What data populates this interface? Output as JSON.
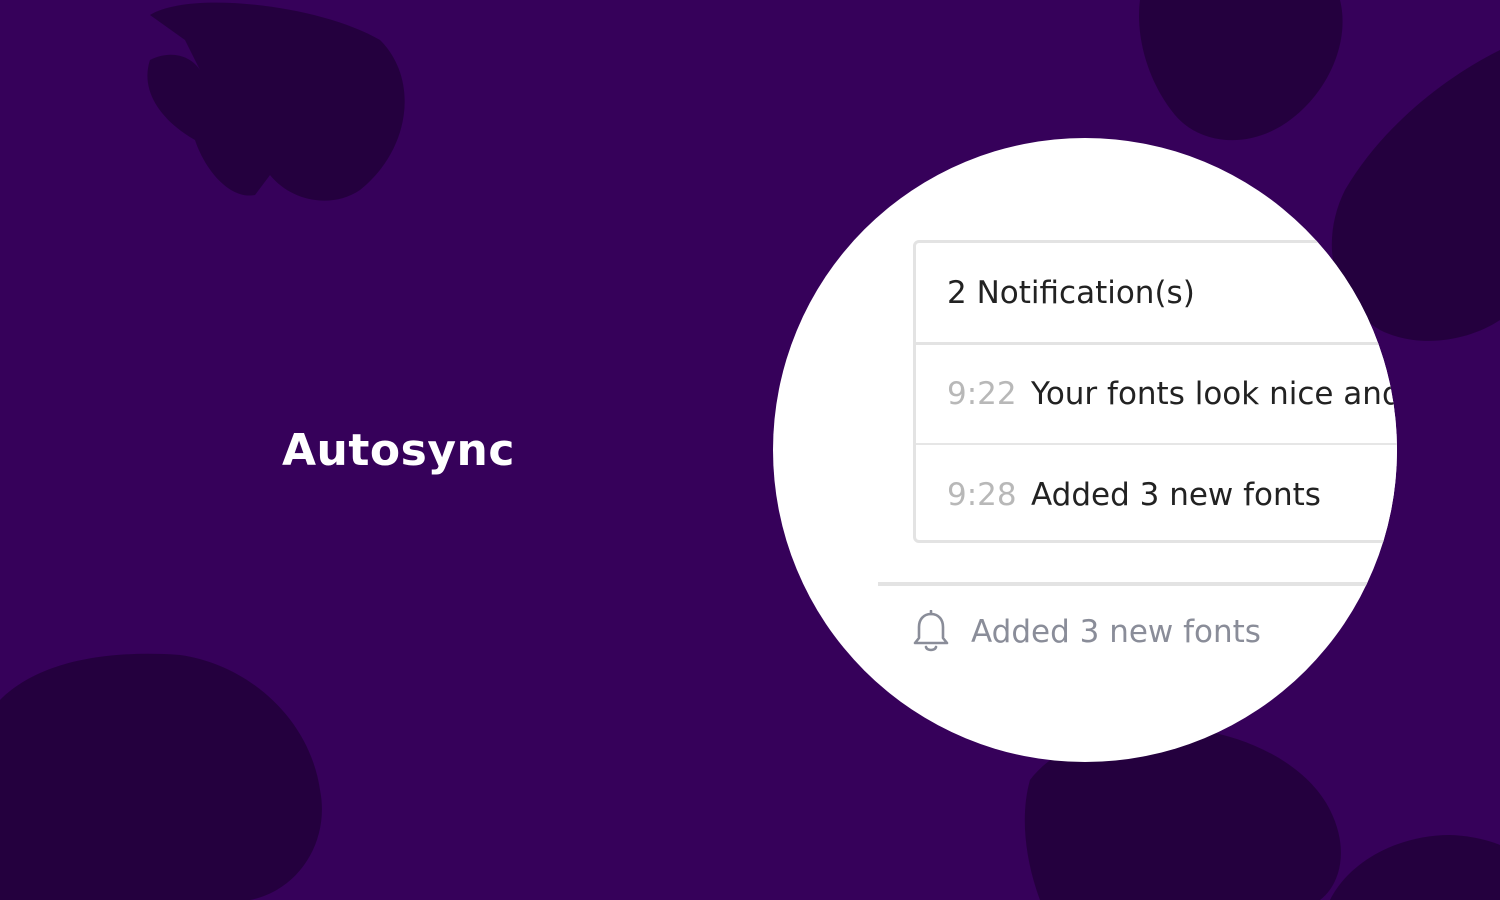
{
  "headline": "Autosync",
  "notifications": {
    "count_label": "2 Notification(s)",
    "items": [
      {
        "time": "9:22",
        "text": "Your fonts look nice and"
      },
      {
        "time": "9:28",
        "text": "Added 3 new fonts"
      }
    ]
  },
  "status_bar": {
    "icon": "bell-icon",
    "text": "Added 3 new fonts"
  },
  "colors": {
    "background": "#36015a",
    "leaf_shadow": "#24003e",
    "headline": "#ffffff",
    "time_text": "#b8b8b8",
    "status_text": "#8a8d99",
    "border": "#e3e3e3"
  }
}
